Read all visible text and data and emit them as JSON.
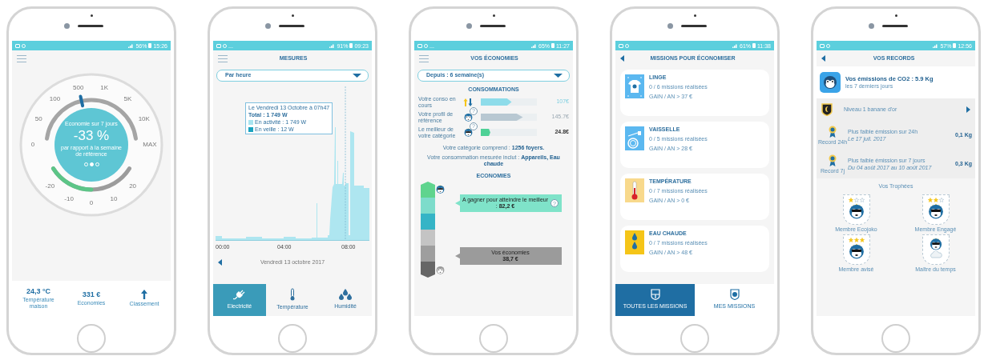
{
  "phones": [
    {
      "kind": "gauge",
      "header": {
        "kind": "menu"
      },
      "status_bar": {
        "battery": "56%",
        "time": "15:26"
      },
      "gauge": {
        "top_labels": [
          "0",
          "50",
          "100",
          "500",
          "1K",
          "5K",
          "10K",
          "MAX"
        ],
        "bottom_labels": [
          "-20",
          "-10",
          "0",
          "10",
          "20"
        ],
        "top_arc": {
          "level": 0.43
        },
        "bottom_arc": {
          "level": 0.5
        },
        "caption": "Economie sur 7 jours",
        "value": "-33 %",
        "note": "par rapport à la semaine de référence",
        "pages": [
          {
            "selected": false
          },
          {
            "selected": true
          },
          {
            "selected": false
          }
        ]
      },
      "stats": [
        {
          "kind": "value",
          "value": "24,3 °C",
          "label": "Température maison"
        },
        {
          "kind": "value",
          "value": "331 €",
          "label": "Economies"
        },
        {
          "kind": "arrow",
          "label": "Classement"
        }
      ]
    },
    {
      "kind": "measures",
      "header": {
        "kind": "menu",
        "title": "MESURES"
      },
      "status_bar": {
        "extra": "...",
        "battery": "91%",
        "time": "09:23"
      },
      "dropdown": "Par heure",
      "tooltip": {
        "date": "Le Vendredi 13 Octobre à 07h47",
        "total": "Total : 1 749 W",
        "legend": [
          {
            "label": "En activité : 1 749 W",
            "color": "#a8e4f0"
          },
          {
            "label": "En veille : 12 W",
            "color": "#1aa3bf"
          }
        ]
      },
      "x_ticks": [
        "00:00",
        "04:00",
        "08:00"
      ],
      "date": "Vendredi 13 octobre 2017",
      "tabs": [
        {
          "kind": "plug",
          "label": "Electricité",
          "selected": true
        },
        {
          "kind": "thermometer",
          "label": "Température",
          "selected": false
        },
        {
          "kind": "drops",
          "label": "Humidité",
          "selected": false
        }
      ]
    },
    {
      "kind": "savings",
      "header": {
        "kind": "menu",
        "title": "VOS ÉCONOMIES"
      },
      "status_bar": {
        "extra": "...",
        "battery": "65%",
        "time": "11:27"
      },
      "dropdown": "Depuis : 6 semaine(s)",
      "section_title": "CONSOMMATIONS",
      "rows": [
        {
          "kind": "arrows",
          "label": "Votre conso en cours",
          "level": 0.55,
          "color": "#8edcea",
          "value": "107€"
        },
        {
          "kind": "monkey",
          "label": "Votre profil de référence",
          "help": "?",
          "level": 0.75,
          "color": "#b8c8d2",
          "value": "145.7€"
        },
        {
          "kind": "champion",
          "label": "Le meilleur de votre catégorie",
          "help": "?",
          "level": 0.17,
          "color": "#4ed196",
          "value": "24.8€"
        }
      ],
      "notes": [
        "Votre catégorie comprend : **1256 foyers.**",
        "Votre consommation mesurée inclut : **Appareils, Eau chaude**"
      ],
      "savings_title": "ECONOMIES",
      "ladder": [
        {
          "color": "#5fd48e"
        },
        {
          "color": "#7ddccb"
        },
        {
          "color": "#35b4c6"
        },
        {
          "color": "#c4c4c4"
        },
        {
          "color": "#9e9e9e"
        },
        {
          "color": "#666666"
        }
      ],
      "bubbles": [
        {
          "kind": "target",
          "text": "A gagner pour atteindre le meilleur : **82,2 €**",
          "help": "?"
        },
        {
          "kind": "current",
          "text": "Vos économies\n**38,7 €**"
        }
      ]
    },
    {
      "kind": "missions",
      "header": {
        "kind": "back",
        "title": "MISSIONS POUR ÉCONOMISER"
      },
      "status_bar": {
        "battery": "61%",
        "time": "11:38"
      },
      "cards": [
        {
          "kind": "laundry",
          "color": "#5bb8f0",
          "title": "LINGE",
          "progress": "0 / 6 missions réalisées",
          "gain": "GAIN / AN > 37 €"
        },
        {
          "kind": "dishes",
          "color": "#5bb8f0",
          "title": "VAISSELLE",
          "progress": "0 / 5 missions réalisées",
          "gain": "GAIN / AN > 28 €"
        },
        {
          "kind": "temperature",
          "color": "#f8d98c",
          "title": "TEMPÉRATURE",
          "progress": "0 / 7 missions réalisées",
          "gain": "GAIN / AN > 0 €"
        },
        {
          "kind": "hot_water",
          "color": "#f5c518",
          "title": "EAU CHAUDE",
          "progress": "0 / 7 missions réalisées",
          "gain": "GAIN / AN > 48 €"
        }
      ],
      "tabs": [
        {
          "kind": "shield",
          "label": "TOUTES LES MISSIONS",
          "selected": true
        },
        {
          "kind": "badge",
          "label": "MES MISSIONS",
          "selected": false
        }
      ]
    },
    {
      "kind": "records",
      "header": {
        "kind": "back",
        "title": "VOS RECORDS"
      },
      "status_bar": {
        "battery": "57%",
        "time": "12:56"
      },
      "summary": {
        "title": "Vos émissions de CO2 : 5.9 Kg",
        "subtitle": "les 7 derniers jours"
      },
      "rank": {
        "text": "Niveau 1 banane d'or"
      },
      "records": [
        {
          "label": "Record 24h",
          "title": "Plus faible émission sur 24h",
          "date": "Le 17 juil. 2017",
          "value": "0,1 Kg"
        },
        {
          "label": "Record 7j",
          "title": "Plus faible émission sur 7 jours",
          "date": "Du 04 août 2017 au 10 août 2017",
          "value": "0,3 Kg"
        }
      ],
      "trophies_title": "Vos Trophées",
      "trophies": [
        {
          "kind": "stars",
          "name": "Membre Ecojoko",
          "stars": 1
        },
        {
          "kind": "stars",
          "name": "Membre Engagé",
          "stars": 2
        },
        {
          "kind": "stars",
          "name": "Membre avisé",
          "stars": 3
        },
        {
          "kind": "weather",
          "name": "Maître du temps"
        }
      ]
    }
  ]
}
